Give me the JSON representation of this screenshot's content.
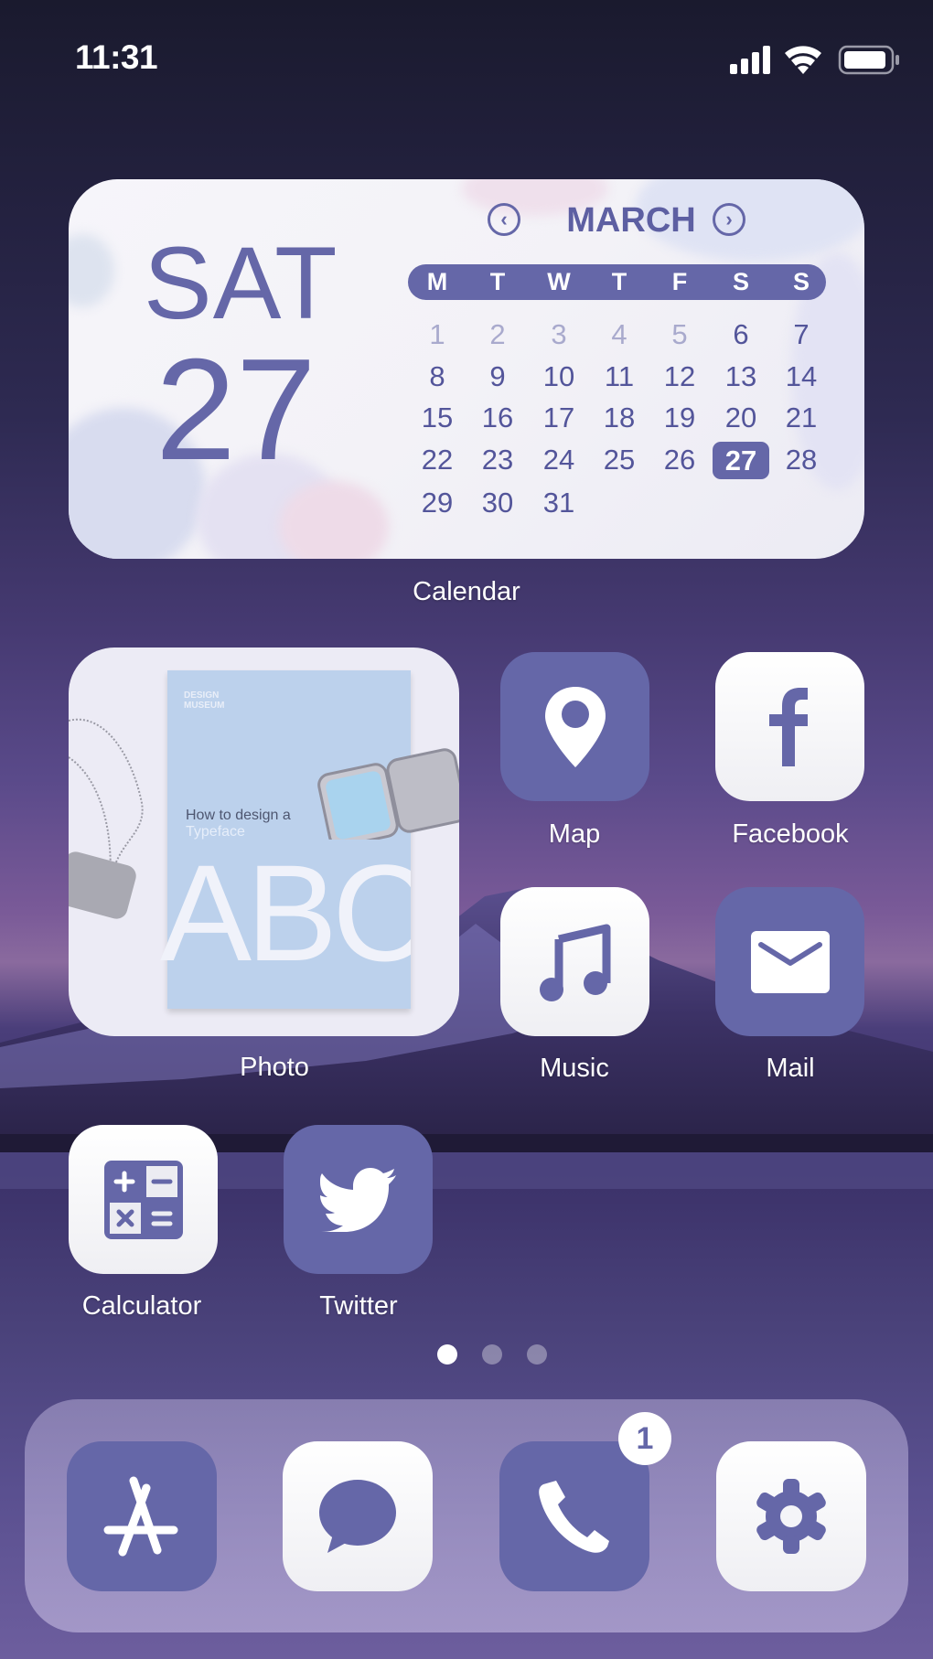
{
  "status_bar": {
    "time": "11:31",
    "icons": [
      "signal-icon",
      "wifi-icon",
      "battery-icon"
    ]
  },
  "calendar_widget": {
    "day_of_week": "SAT",
    "day_number": "27",
    "month": "MARCH",
    "prev_icon": "‹",
    "next_icon": "›",
    "weekday_headers": [
      "M",
      "T",
      "W",
      "T",
      "F",
      "S",
      "S"
    ],
    "weeks": [
      [
        "1",
        "2",
        "3",
        "4",
        "5",
        "6",
        "7"
      ],
      [
        "8",
        "9",
        "10",
        "11",
        "12",
        "13",
        "14"
      ],
      [
        "15",
        "16",
        "17",
        "18",
        "19",
        "20",
        "21"
      ],
      [
        "22",
        "23",
        "24",
        "25",
        "26",
        "27",
        "28"
      ],
      [
        "29",
        "30",
        "31",
        "",
        "",
        "",
        ""
      ]
    ],
    "faded_dates": [
      "1",
      "2",
      "3",
      "4",
      "5"
    ],
    "today": "27",
    "label": "Calendar"
  },
  "photo_widget": {
    "label": "Photo",
    "book_publisher_line1": "DESIGN",
    "book_publisher_line2": "MUSEUM",
    "book_title_line1": "How to design a",
    "book_title_line2": "Typeface",
    "book_big_text": "ABC"
  },
  "apps": [
    {
      "name": "Map",
      "icon": "map-pin-icon",
      "style": "purple"
    },
    {
      "name": "Facebook",
      "icon": "facebook-icon",
      "style": "white"
    },
    {
      "name": "Music",
      "icon": "music-note-icon",
      "style": "white"
    },
    {
      "name": "Mail",
      "icon": "mail-icon",
      "style": "purple"
    },
    {
      "name": "Calculator",
      "icon": "calculator-icon",
      "style": "white"
    },
    {
      "name": "Twitter",
      "icon": "twitter-bird-icon",
      "style": "purple"
    }
  ],
  "page_indicator": {
    "pages": 3,
    "current": 1
  },
  "dock": {
    "apps": [
      {
        "name": "App Store",
        "icon": "app-store-icon",
        "style": "purple"
      },
      {
        "name": "Messages",
        "icon": "message-bubble-icon",
        "style": "white"
      },
      {
        "name": "Phone",
        "icon": "phone-icon",
        "style": "purple",
        "badge": "1"
      },
      {
        "name": "Settings",
        "icon": "gear-icon",
        "style": "white"
      }
    ]
  },
  "colors": {
    "accent": "#6567a8",
    "faded_date": "#a9aacd",
    "white": "#ffffff"
  }
}
